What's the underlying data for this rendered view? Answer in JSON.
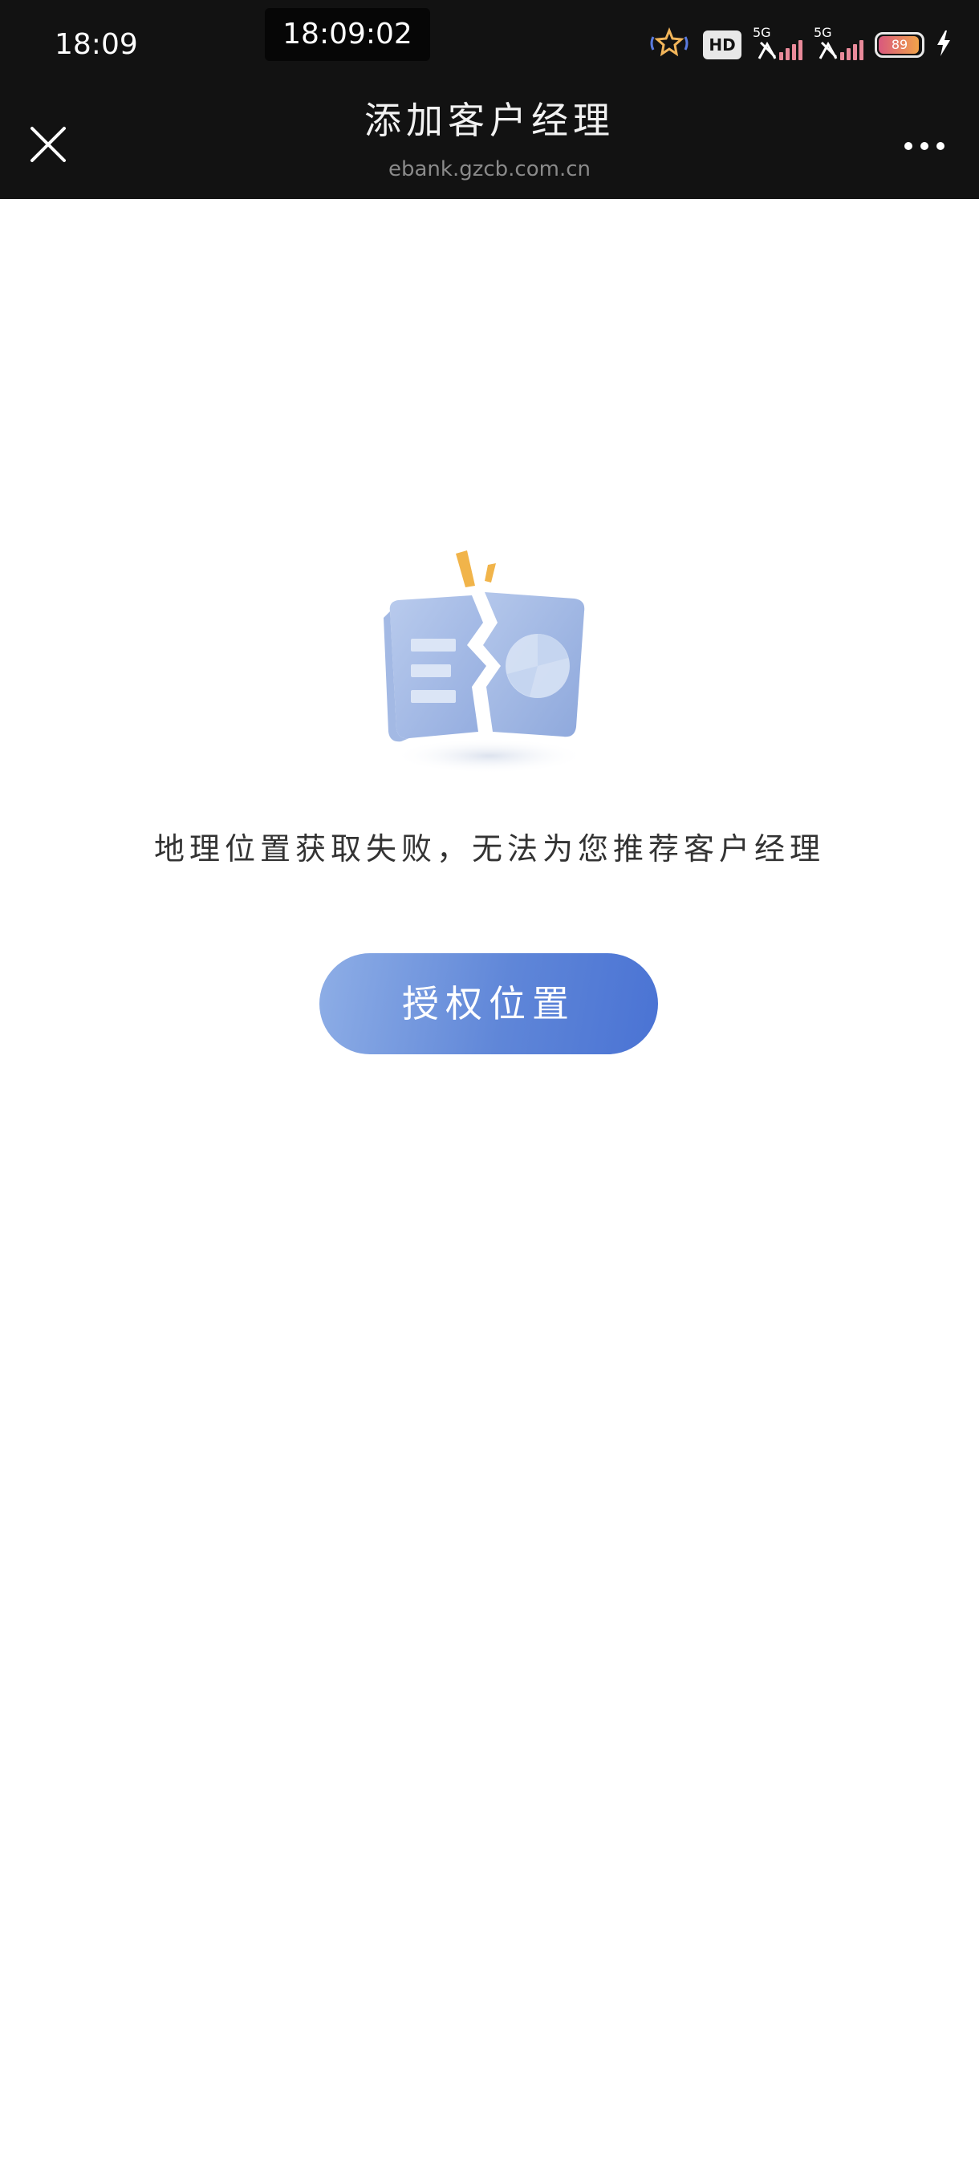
{
  "status_bar": {
    "time": "18:09",
    "overlay_clock": "18:09:02",
    "hd_label": "HD",
    "sim1_network": "5G",
    "sim2_network": "5G",
    "battery_level": "89",
    "icons": [
      "notification-icon",
      "hd-voice-icon",
      "signal-sim1-icon",
      "signal-sim2-icon",
      "battery-icon",
      "charging-icon"
    ]
  },
  "header": {
    "title": "添加客户经理",
    "url": "ebank.gzcb.com.cn",
    "close_icon": "close-icon",
    "more_icon": "more-icon"
  },
  "main": {
    "illustration_icon": "broken-document-icon",
    "error_message": "地理位置获取失败，无法为您推荐客户经理",
    "authorize_button_label": "授权位置"
  },
  "colors": {
    "header_bg": "#121212",
    "button_gradient_start": "#8eaee6",
    "button_gradient_end": "#4a73d4",
    "illustration_blue": "#a9bfe6",
    "illustration_orange": "#f1b44a"
  }
}
